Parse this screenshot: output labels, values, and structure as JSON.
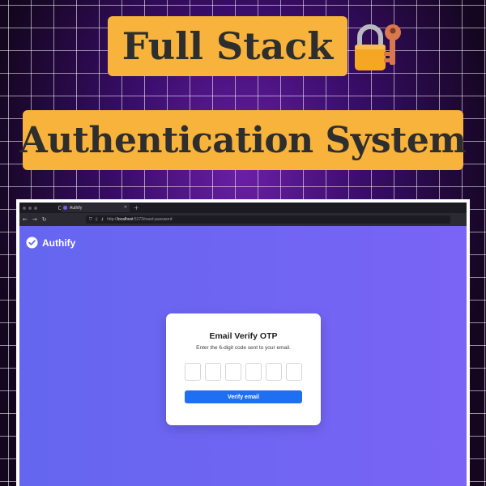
{
  "banner": {
    "line1": "Full Stack",
    "line2": "Authentication System",
    "icon": "lock-with-key-icon"
  },
  "browser": {
    "tab_title": "Authify",
    "url_host": "localhost",
    "url_prefix": "http://",
    "url_rest": ":5173/reset-password"
  },
  "app": {
    "brand_name": "Authify",
    "card": {
      "title": "Email Verify OTP",
      "subtitle": "Enter the 6-digit code sent to your email.",
      "otp_digits": [
        "",
        "",
        "",
        "",
        "",
        ""
      ],
      "submit_label": "Verify email"
    }
  },
  "colors": {
    "banner_bg": "#f7b33b",
    "viewport_gradient_start": "#6466f0",
    "viewport_gradient_end": "#7a64f5",
    "primary_button": "#1f6ff2"
  }
}
